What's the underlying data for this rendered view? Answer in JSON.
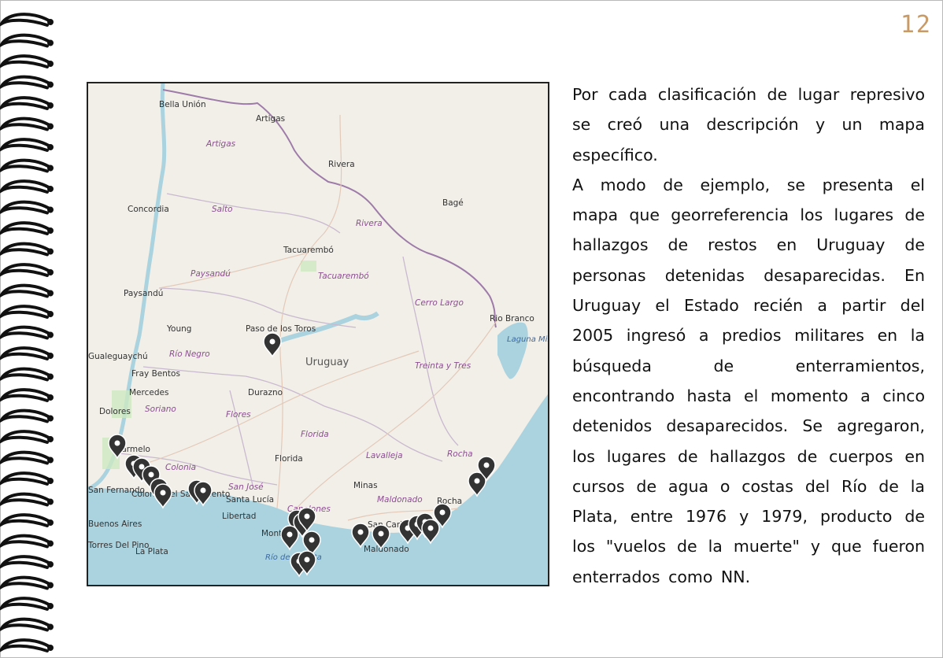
{
  "page": {
    "number": "12"
  },
  "paragraphs": [
    "Por cada clasificación de lugar represivo se creó una descripción y un mapa específico.",
    "A modo de ejemplo, se presenta el mapa que georreferencia los lugares de hallazgos de restos en Uruguay de personas detenidas desaparecidas. En Uruguay el Estado recién a partir del 2005 ingresó a predios militares en la búsqueda de enterramientos, encontrando hasta el momento a cinco detenidos desaparecidos. Se agregaron, los lugares de hallazgos de cuerpos en cursos de agua o costas del Río de la Plata, entre 1976 y 1979, producto de los \"vuelos de la muerte\" y que fueron enterrados como NN."
  ],
  "map": {
    "country": "Uruguay",
    "cities": [
      "Bella Unión",
      "Artigas",
      "Rivera",
      "Bagé",
      "Concordia",
      "Tacuarembó",
      "Paysandú",
      "Young",
      "Paso de los Toros",
      "Rio Branco",
      "Gualeguaychú",
      "Fray Bentos",
      "Mercedes",
      "Durazno",
      "Dolores",
      "Carmelo",
      "Florida",
      "Minas",
      "Santa Lucía",
      "Colonia del Sacramento",
      "Libertad",
      "Montevideo",
      "San Carlos",
      "Maldonado",
      "Rocha",
      "Buenos Aires",
      "La Plata",
      "Torres Del Pino",
      "San Fernando"
    ],
    "departments": [
      "Artigas",
      "Salto",
      "Rivera",
      "Paysandú",
      "Tacuarembó",
      "Cerro Largo",
      "Río Negro",
      "Treinta y Tres",
      "Soriano",
      "Flores",
      "Florida",
      "Lavalleja",
      "Rocha",
      "Colonia",
      "San José",
      "Canelones",
      "Maldonado"
    ],
    "water": [
      "Laguna Mirim / Lagoa Merín",
      "Río de la Plata"
    ],
    "colors": {
      "land": "#f2efe9",
      "water": "#aad3df",
      "border": "#9e7ba8",
      "marker": "#333333",
      "page_number": "#c79a68"
    }
  }
}
